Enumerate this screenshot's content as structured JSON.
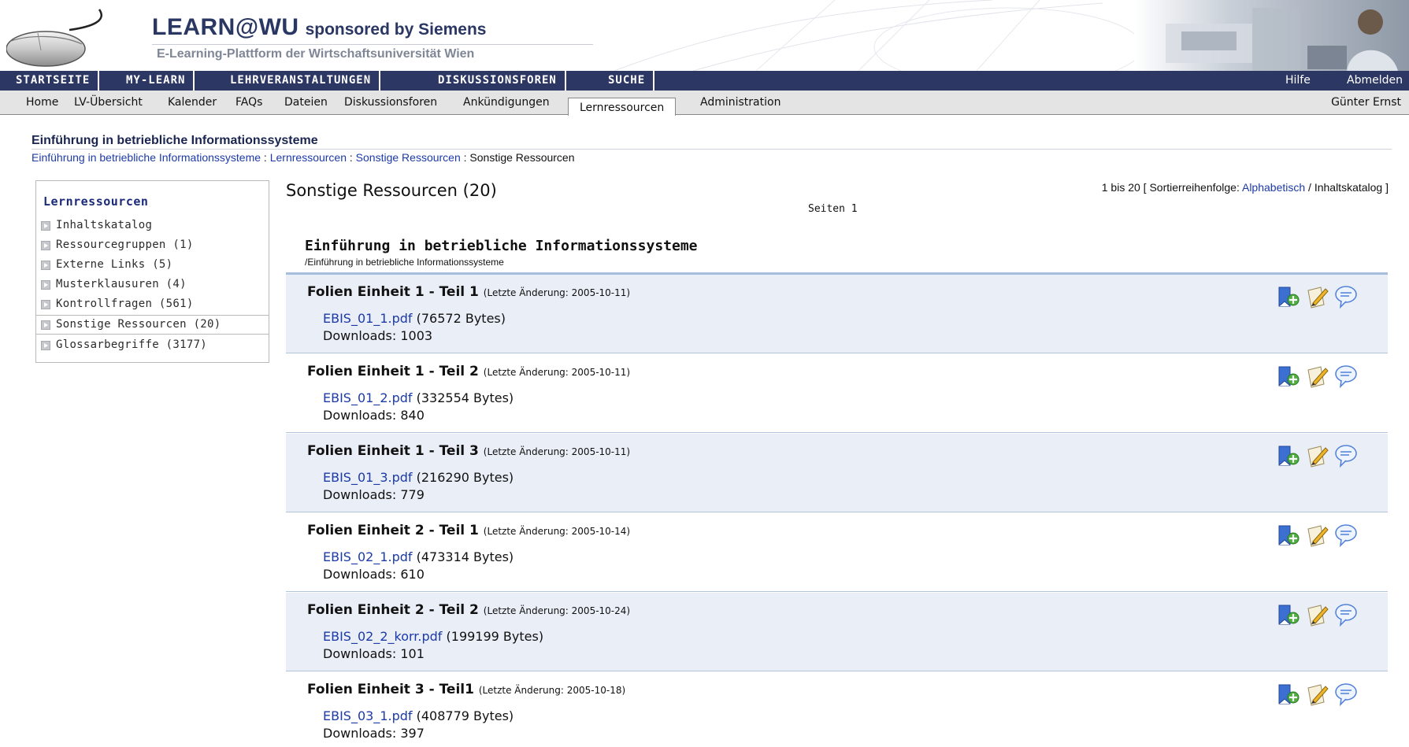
{
  "header": {
    "brand": "LEARN@WU",
    "sponsor": "sponsored by Siemens",
    "subtitle": "E-Learning-Plattform der Wirtschaftsuniversität Wien"
  },
  "main_nav": {
    "items": [
      "STARTSEITE",
      "MY-LEARN",
      "LEHRVERANSTALTUNGEN",
      "DISKUSSIONSFOREN",
      "SUCHE"
    ],
    "help": "Hilfe",
    "logout": "Abmelden"
  },
  "sub_nav": {
    "items": [
      "Home",
      "LV-Übersicht",
      "Kalender",
      "FAQs",
      "Dateien",
      "Diskussionsforen",
      "Ankündigungen"
    ],
    "active": "Lernressourcen",
    "after": "Administration",
    "user": "Günter Ernst"
  },
  "course": {
    "title": "Einführung in betriebliche Informationssysteme",
    "breadcrumb": {
      "links": [
        "Einführung in betriebliche Informationssysteme",
        "Lernressourcen",
        "Sonstige Ressourcen"
      ],
      "separator": " : ",
      "current": "Sonstige Ressourcen"
    }
  },
  "sidebar": {
    "title": "Lernressourcen",
    "items": [
      {
        "label": "Inhaltskatalog"
      },
      {
        "label": "Ressourcegruppen (1)"
      },
      {
        "label": "Externe Links (5)"
      },
      {
        "label": "Musterklausuren (4)"
      },
      {
        "label": "Kontrollfragen (561)"
      },
      {
        "label": "Sonstige Ressourcen (20)",
        "active": true
      },
      {
        "label": "Glossarbegriffe (3177)"
      }
    ]
  },
  "content": {
    "title": "Sonstige Ressourcen (20)",
    "pages": "Seiten  1",
    "sort": {
      "prefix": "1 bis 20 [ Sortierreihenfolge: ",
      "link": "Alphabetisch",
      "suffix": " / Inhaltskatalog ]"
    },
    "group_title": "Einführung in betriebliche Informationssysteme",
    "group_path": "/Einführung in betriebliche Informationssysteme",
    "downloads_label": "Downloads: ",
    "resources": [
      {
        "title_main": "Folien Einheit 1 - Teil 1",
        "meta": "(Letzte Änderung: 2005-10-11)",
        "file": "EBIS_01_1.pdf",
        "size": "(76572 Bytes)",
        "downloads": "1003"
      },
      {
        "title_main": "Folien Einheit 1 - Teil 2",
        "meta": "(Letzte Änderung: 2005-10-11)",
        "file": "EBIS_01_2.pdf",
        "size": "(332554 Bytes)",
        "downloads": "840"
      },
      {
        "title_main": "Folien Einheit 1 - Teil 3",
        "meta": "(Letzte Änderung: 2005-10-11)",
        "file": "EBIS_01_3.pdf",
        "size": "(216290 Bytes)",
        "downloads": "779"
      },
      {
        "title_main": "Folien Einheit 2 - Teil 1",
        "meta": "(Letzte Änderung: 2005-10-14)",
        "file": "EBIS_02_1.pdf",
        "size": "(473314 Bytes)",
        "downloads": "610"
      },
      {
        "title_main": "Folien Einheit 2 - Teil 2",
        "meta": "(Letzte Änderung: 2005-10-24)",
        "file": "EBIS_02_2_korr.pdf",
        "size": "(199199 Bytes)",
        "downloads": "101"
      },
      {
        "title_main": "Folien Einheit 3 - Teil1",
        "meta": "(Letzte Änderung: 2005-10-18)",
        "file": "EBIS_03_1.pdf",
        "size": "(408779 Bytes)",
        "downloads": "397"
      }
    ]
  },
  "icons": [
    "bookmark-add-icon",
    "edit-icon",
    "comment-icon"
  ],
  "colors": {
    "nav_bg": "#2c3764",
    "link": "#1c3aa8",
    "shade": "#e9eef7"
  }
}
